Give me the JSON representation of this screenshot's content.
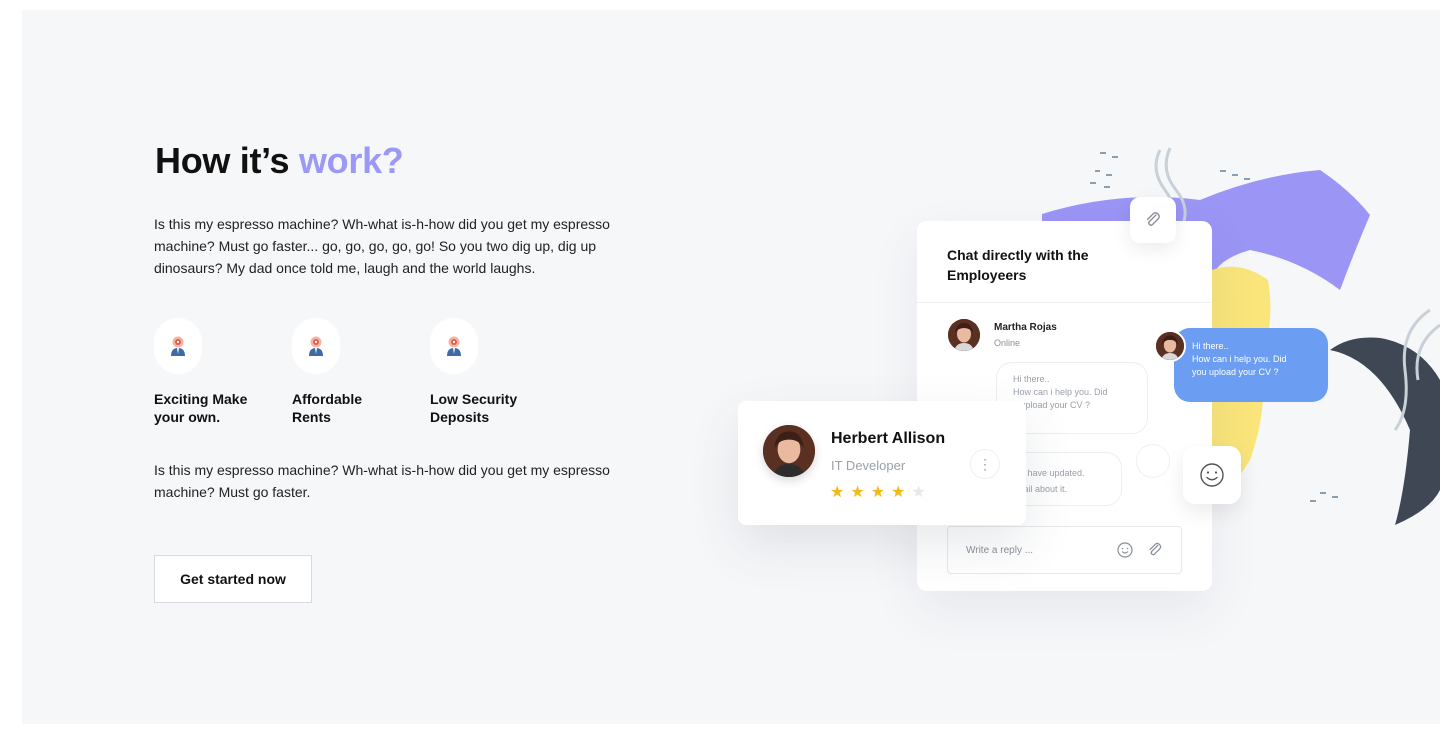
{
  "colors": {
    "accent": "#9b98f7",
    "chat_blue": "#6b9ef3",
    "star_filled": "#f5b916",
    "star_empty": "#e6e8ec",
    "deco_purple": "#9b95f6",
    "deco_yellow": "#f9e57a",
    "deco_dark": "#3e4753"
  },
  "hero": {
    "title_prefix": "How it’s ",
    "title_accent": "work?",
    "intro": "Is this my espresso machine? Wh-what is-h-how did you get my espresso machine? Must go faster... go, go, go, go, go! So you two dig up, dig up dinosaurs? My dad once told me, laugh and the world laughs.",
    "features": [
      {
        "icon": "person-target-icon",
        "label_line1": "Exciting Make",
        "label_line2": "your own."
      },
      {
        "icon": "person-target-icon",
        "label_line1": "Affordable",
        "label_line2": "Rents"
      },
      {
        "icon": "person-target-icon",
        "label_line1": "Low Security",
        "label_line2": "Deposits"
      }
    ],
    "outro": "Is this my espresso machine? Wh-what is-h-how did you get my espresso machine? Must go faster.",
    "cta_label": "Get started now"
  },
  "chat": {
    "title_line1": "Chat directly with the",
    "title_line2": "Employeers",
    "contact_name": "Martha Rojas",
    "contact_status": "Online",
    "incoming_1": [
      "Hi there..",
      "How can i help you. Did",
      "u upload your CV ?"
    ],
    "incoming_2": [
      "es i have updated.",
      "detail about it."
    ],
    "outgoing": [
      "Hi there..",
      "How can i help you. Did",
      "you upload your CV ?"
    ],
    "reply_placeholder": "Write a reply ..."
  },
  "profile": {
    "name": "Herbert Allison",
    "role": "IT Developer",
    "rating": 4,
    "rating_max": 5
  }
}
